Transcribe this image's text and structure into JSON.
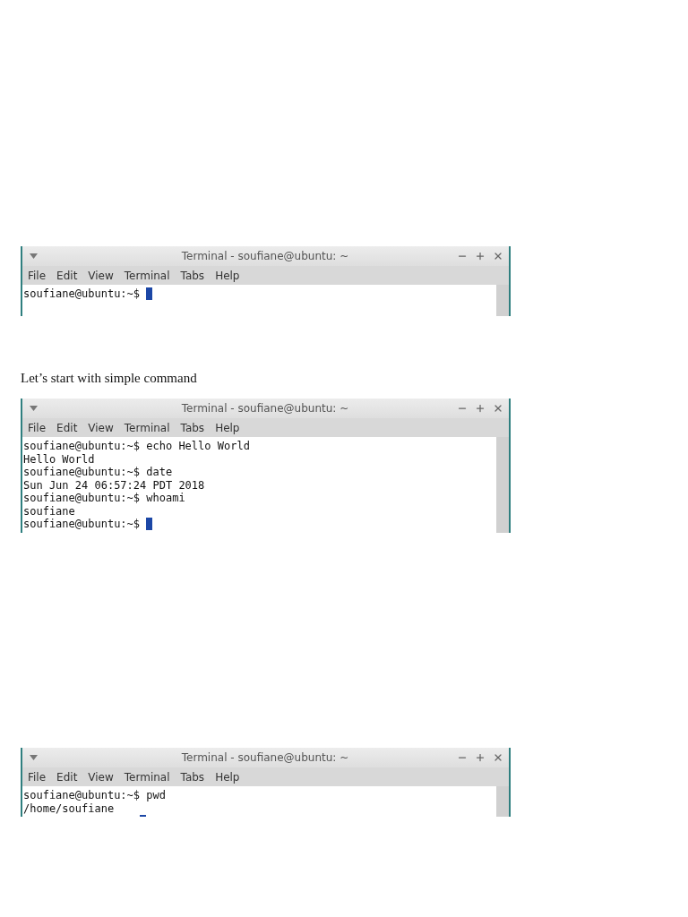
{
  "blocks": [
    {
      "kind": "terminal",
      "title": "Terminal - soufiane@ubuntu: ~",
      "menu": [
        "File",
        "Edit",
        "View",
        "Terminal",
        "Tabs",
        "Help"
      ],
      "lines": [
        {
          "text": "soufiane@ubuntu:~$",
          "cursor": true
        }
      ]
    },
    {
      "kind": "text",
      "text": "Let’s start with simple command"
    },
    {
      "kind": "terminal",
      "title": "Terminal - soufiane@ubuntu: ~",
      "menu": [
        "File",
        "Edit",
        "View",
        "Terminal",
        "Tabs",
        "Help"
      ],
      "lines": [
        {
          "text": "soufiane@ubuntu:~$ echo Hello World",
          "cursor": false
        },
        {
          "text": "Hello World",
          "cursor": false
        },
        {
          "text": "soufiane@ubuntu:~$ date",
          "cursor": false
        },
        {
          "text": "Sun Jun 24 06:57:24 PDT 2018",
          "cursor": false
        },
        {
          "text": "soufiane@ubuntu:~$ whoami",
          "cursor": false
        },
        {
          "text": "soufiane",
          "cursor": false
        },
        {
          "text": "soufiane@ubuntu:~$",
          "cursor": true
        }
      ]
    },
    {
      "kind": "terminal",
      "title": "Terminal - soufiane@ubuntu: ~",
      "menu": [
        "File",
        "Edit",
        "View",
        "Terminal",
        "Tabs",
        "Help"
      ],
      "lines": [
        {
          "text": "soufiane@ubuntu:~$ pwd",
          "cursor": false
        },
        {
          "text": "/home/soufiane",
          "cursor": false
        },
        {
          "cursor": true
        }
      ]
    }
  ]
}
